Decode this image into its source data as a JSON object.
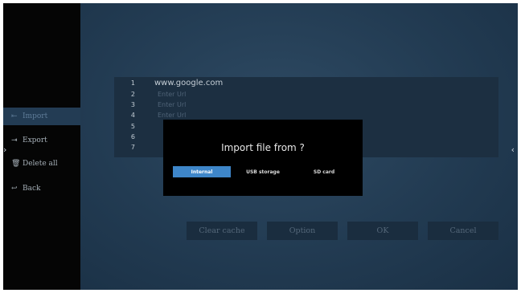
{
  "sidebar": {
    "items": [
      {
        "label": "Import",
        "icon": "import-icon",
        "glyph": "⇤",
        "active": true
      },
      {
        "label": "Export",
        "icon": "export-icon",
        "glyph": "⇥",
        "active": false
      },
      {
        "label": "Delete all",
        "icon": "trash-icon",
        "glyph": "🗑",
        "active": false
      },
      {
        "label": "Back",
        "icon": "back-icon",
        "glyph": "↩",
        "active": false
      }
    ]
  },
  "url_list": {
    "rows": [
      {
        "num": "1",
        "value": "www.google.com"
      },
      {
        "num": "2",
        "value": "Enter Url"
      },
      {
        "num": "3",
        "value": "Enter Url"
      },
      {
        "num": "4",
        "value": "Enter Url"
      },
      {
        "num": "5",
        "value": ""
      },
      {
        "num": "6",
        "value": ""
      },
      {
        "num": "7",
        "value": ""
      }
    ]
  },
  "buttons": {
    "clear_cache": "Clear cache",
    "option": "Option",
    "ok": "OK",
    "cancel": "Cancel"
  },
  "dialog": {
    "title": "Import file from ?",
    "options": [
      "Internal",
      "USB storage",
      "SD card"
    ],
    "selected": "Internal"
  },
  "colors": {
    "accent": "#3e86c9",
    "sidebar_active": "#233c54",
    "background": "#223b52"
  }
}
